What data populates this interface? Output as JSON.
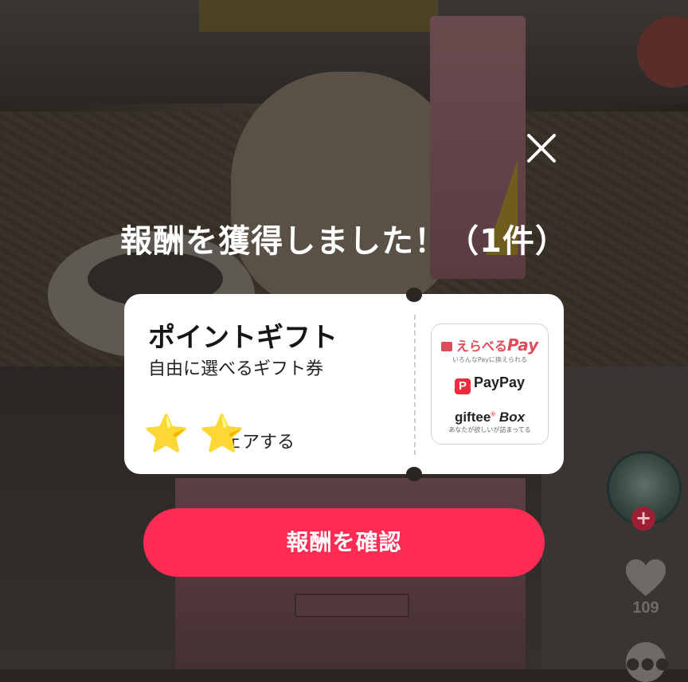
{
  "reward_dialog": {
    "title": "報酬を獲得しました！（1件）",
    "close_icon": "close-icon",
    "ticket": {
      "gift_title": "ポイントギフト",
      "gift_subtitle": "自由に選べるギフト券",
      "share_text": "ェアする",
      "star_icon": "star-icon",
      "brands": {
        "erabe_name": "えらべる",
        "erabe_pay": "Pay",
        "erabe_tagline": "いろんなPayに換えられる",
        "paypay_name": "PayPay",
        "giftee_name": "giftee",
        "giftee_box": "Box",
        "giftee_tagline": "あなたが欲しいが詰まってる"
      }
    },
    "confirm_button": "報酬を確認"
  },
  "right_rail": {
    "avatar_icon": "avatar",
    "follow_icon": "plus-icon",
    "like_icon": "heart-icon",
    "like_count": "109",
    "more_icon": "more-icon"
  },
  "colors": {
    "accent": "#fe2c55",
    "overlay": "#2a2622",
    "ticket": "#ffffff"
  }
}
